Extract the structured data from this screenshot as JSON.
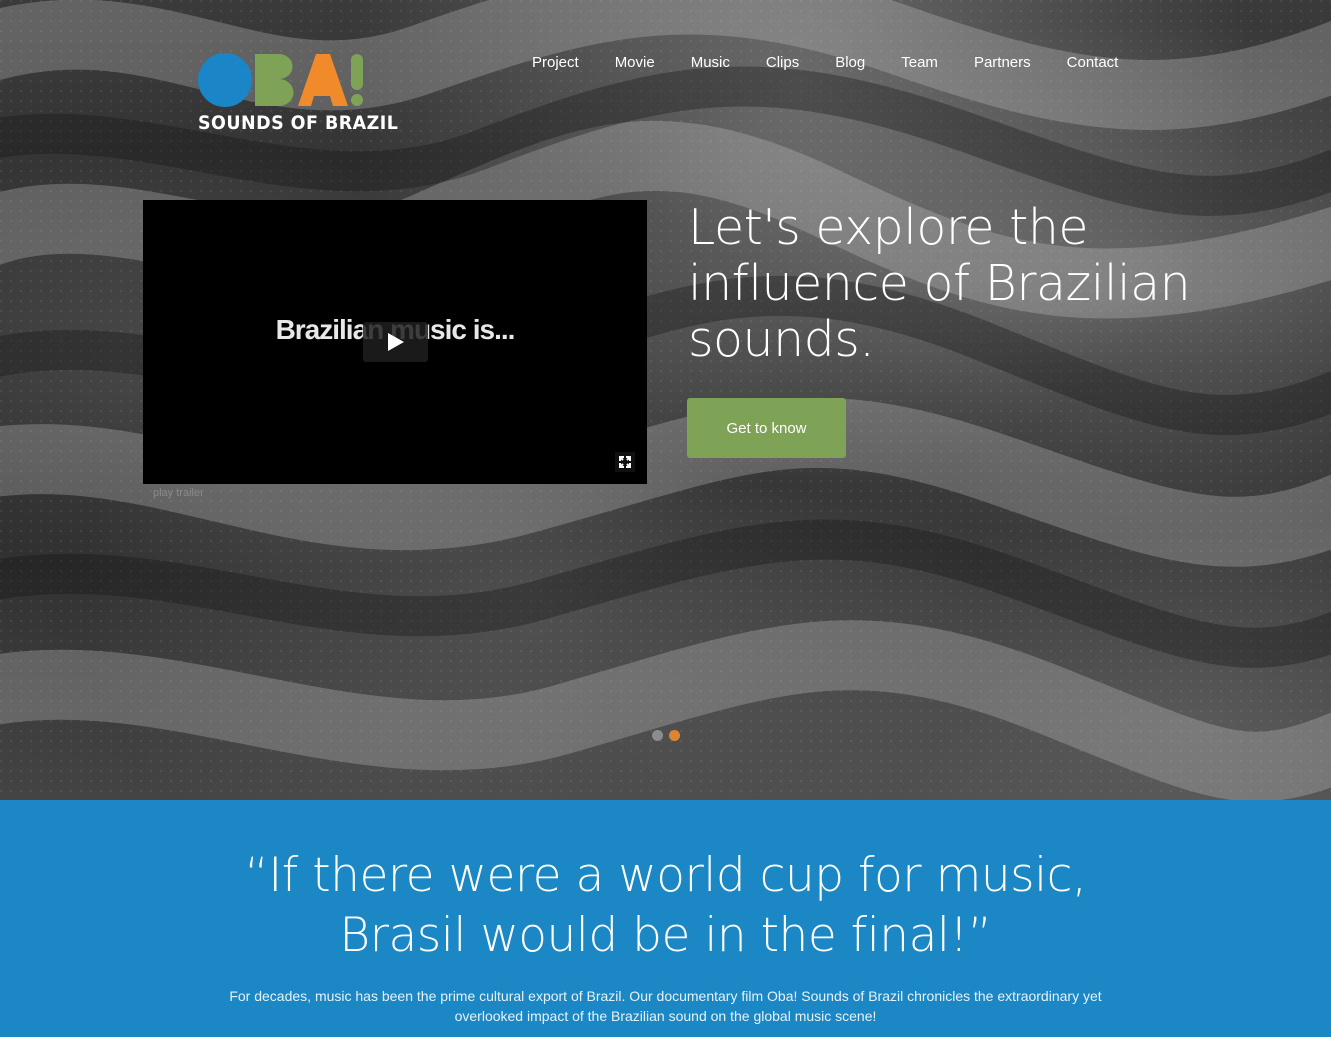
{
  "brand": {
    "logo_letters": [
      "O",
      "B",
      "A",
      "!"
    ],
    "tagline": "SOUNDS OF BRAZIL",
    "colors": {
      "o": "#1a86c7",
      "b": "#7ea356",
      "a": "#f08a2b",
      "bang": "#7ea356"
    }
  },
  "nav": {
    "items": [
      "Project",
      "Movie",
      "Music",
      "Clips",
      "Blog",
      "Team",
      "Partners",
      "Contact"
    ]
  },
  "hero": {
    "video": {
      "overlay_text": "Brazilian music is...",
      "play_icon": "play-icon",
      "fullscreen_icon": "fullscreen-icon",
      "caption": "play trailer"
    },
    "headline": "Let's explore the influence of Brazilian sounds.",
    "cta_label": "Get to know",
    "slider_dots": [
      {
        "active": false,
        "color": "#8c8c8c"
      },
      {
        "active": true,
        "color": "#e0832f"
      }
    ]
  },
  "quote_section": {
    "quote_line1": "“If there were a world cup for music,",
    "quote_line2": "Brasil would be in the final!”",
    "intro": "For decades, music has been the prime cultural export of Brazil. Our documentary film Oba! Sounds of Brazil chronicles the extraordinary yet overlooked impact of the Brazilian sound on the global music scene!",
    "background_color": "#1b87c4"
  },
  "accent_colors": {
    "cta": "#7ea356",
    "blue": "#1b87c4",
    "orange": "#e0832f"
  }
}
